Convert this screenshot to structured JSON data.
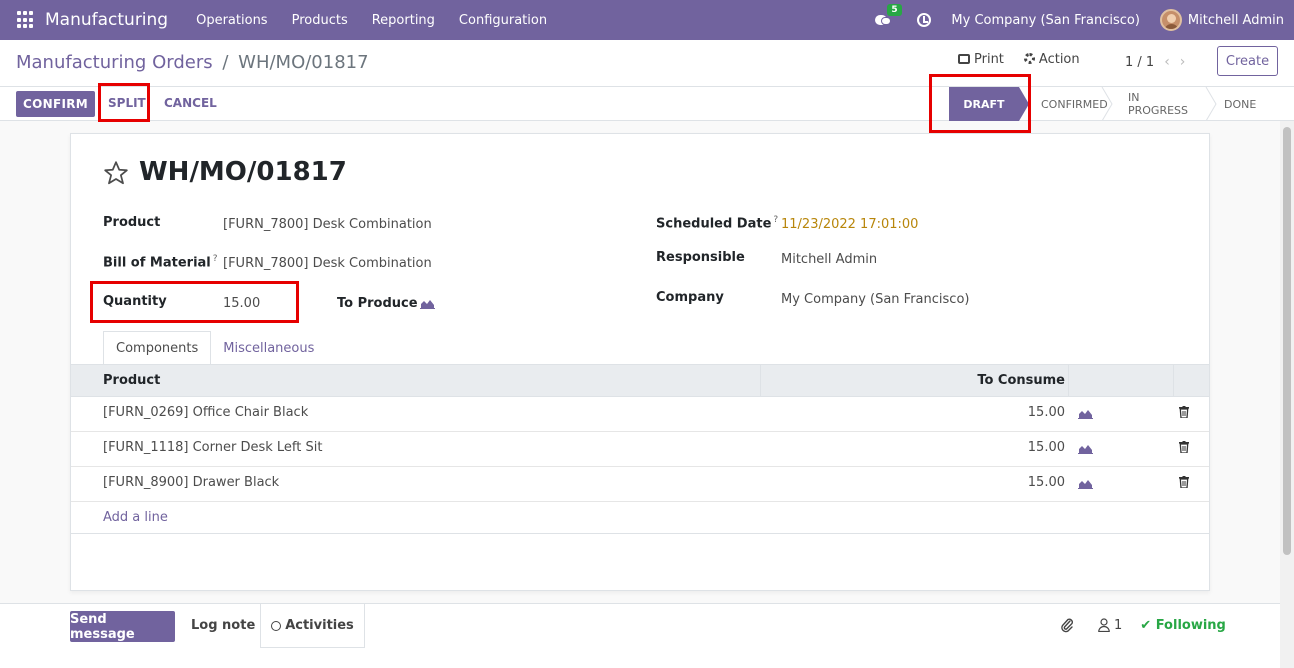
{
  "navbar": {
    "app_name": "Manufacturing",
    "menu": [
      "Operations",
      "Products",
      "Reporting",
      "Configuration"
    ],
    "chat_count": "5",
    "company": "My Company (San Francisco)",
    "user": "Mitchell Admin"
  },
  "control_panel": {
    "breadcrumb_parent": "Manufacturing Orders",
    "breadcrumb_separator": "/",
    "breadcrumb_current": "WH/MO/01817",
    "print_label": "Print",
    "action_label": "Action",
    "pager": "1 / 1",
    "create_label": "Create"
  },
  "statusbar": {
    "confirm_label": "CONFIRM",
    "split_label": "SPLIT",
    "cancel_label": "CANCEL",
    "stages": [
      "DRAFT",
      "CONFIRMED",
      "IN PROGRESS",
      "DONE"
    ],
    "active_stage": "DRAFT"
  },
  "form": {
    "title": "WH/MO/01817",
    "product_label": "Product",
    "product_value": "[FURN_7800] Desk Combination",
    "bom_label": "Bill of Material",
    "bom_value": "[FURN_7800] Desk Combination",
    "quantity_label": "Quantity",
    "quantity_value": "15.00",
    "to_produce_label": "To Produce",
    "scheduled_date_label": "Scheduled Date",
    "scheduled_date_value": "11/23/2022 17:01:00",
    "responsible_label": "Responsible",
    "responsible_value": "Mitchell Admin",
    "company_label": "Company",
    "company_value": "My Company (San Francisco)",
    "help_mark": "?"
  },
  "tabs": [
    "Components",
    "Miscellaneous"
  ],
  "components_table": {
    "headers": [
      "Product",
      "To Consume"
    ],
    "rows": [
      {
        "product": "[FURN_0269] Office Chair Black",
        "to_consume": "15.00"
      },
      {
        "product": "[FURN_1118] Corner Desk Left Sit",
        "to_consume": "15.00"
      },
      {
        "product": "[FURN_8900] Drawer Black",
        "to_consume": "15.00"
      }
    ],
    "add_line": "Add a line"
  },
  "chatter": {
    "send_message": "Send message",
    "log_note": "Log note",
    "activities": "Activities",
    "followers_count": "1",
    "following": "Following"
  },
  "colors": {
    "brand": "#71639e",
    "annotation": "#e60000",
    "success": "#28a745",
    "date": "#b8860b"
  }
}
